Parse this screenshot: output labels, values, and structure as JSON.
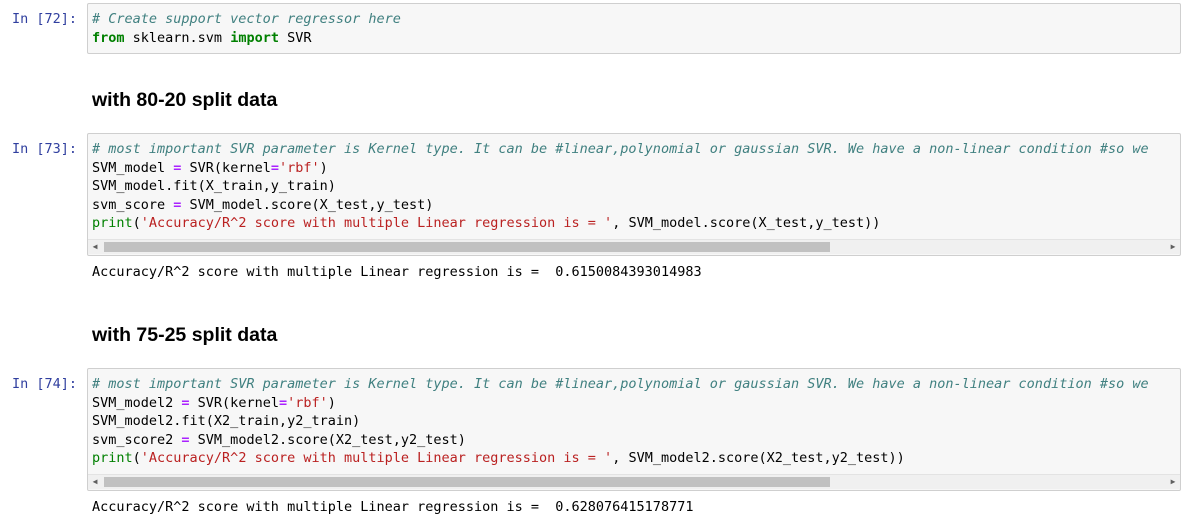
{
  "cell72": {
    "prompt": "In [72]:",
    "line1": "# Create support vector regressor here",
    "line2_kw_from": "from",
    "line2_mod": " sklearn.svm ",
    "line2_kw_import": "import",
    "line2_rest": " SVR"
  },
  "heading1": "with 80-20 split data",
  "cell73": {
    "prompt": "In [73]:",
    "comment": "# most important SVR parameter is Kernel type. It can be #linear,polynomial or gaussian SVR. We have a non-linear condition #so we",
    "l2a": "SVM_model ",
    "l2op": "=",
    "l2b": " SVR(kernel",
    "l2op2": "=",
    "l2str": "'rbf'",
    "l2c": ")",
    "l3": "SVM_model.fit(X_train,y_train)",
    "l4a": "svm_score ",
    "l4op": "=",
    "l4b": " SVM_model.score(X_test,y_test)",
    "l5print": "print",
    "l5a": "(",
    "l5str": "'Accuracy/R^2 score with multiple Linear regression is = '",
    "l5b": ", SVM_model.score(X_test,y_test))",
    "output": "Accuracy/R^2 score with multiple Linear regression is =  0.6150084393014983"
  },
  "heading2": "with 75-25 split data",
  "cell74": {
    "prompt": "In [74]:",
    "comment": "# most important SVR parameter is Kernel type. It can be #linear,polynomial or gaussian SVR. We have a non-linear condition #so we",
    "l2a": "SVM_model2 ",
    "l2op": "=",
    "l2b": " SVR(kernel",
    "l2op2": "=",
    "l2str": "'rbf'",
    "l2c": ")",
    "l3": "SVM_model2.fit(X2_train,y2_train)",
    "l4a": "svm_score2 ",
    "l4op": "=",
    "l4b": " SVM_model2.score(X2_test,y2_test)",
    "l5print": "print",
    "l5a": "(",
    "l5str": "'Accuracy/R^2 score with multiple Linear regression is = '",
    "l5b": ", SVM_model2.score(X2_test,y2_test))",
    "output": "Accuracy/R^2 score with multiple Linear regression is =  0.628076415178771"
  },
  "scroll": {
    "left_arrow": "◀",
    "right_arrow": "▶"
  }
}
